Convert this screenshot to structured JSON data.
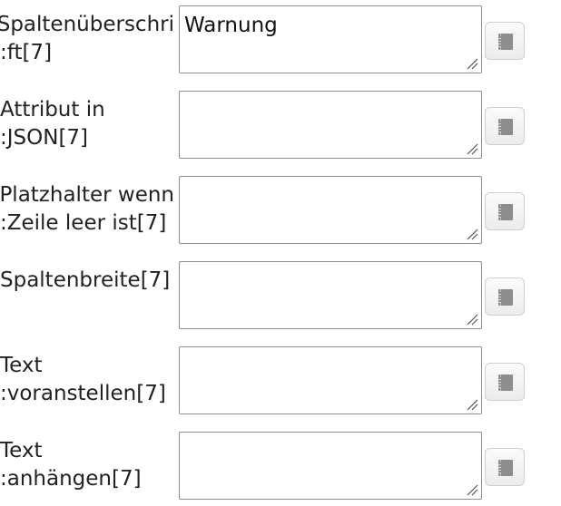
{
  "rows": [
    {
      "label_line1": "Spaltenüberschri",
      "label_line2": "ft[7]:",
      "value": "Warnung",
      "button_icon": "book-icon"
    },
    {
      "label_line1": "Attribut in",
      "label_line2": "JSON[7]:",
      "value": "",
      "button_icon": "book-icon"
    },
    {
      "label_line1": "Platzhalter wenn",
      "label_line2": "Zeile leer ist[7]:",
      "value": "",
      "button_icon": "book-icon"
    },
    {
      "label_line1": "Spaltenbreite[7]",
      "label_line2": "",
      "value": "",
      "button_icon": "book-icon"
    },
    {
      "label_line1": "Text",
      "label_line2": "voranstellen[7]:",
      "value": "",
      "button_icon": "book-icon"
    },
    {
      "label_line1": "Text",
      "label_line2": "anhängen[7]:",
      "value": "",
      "button_icon": "book-icon"
    }
  ]
}
